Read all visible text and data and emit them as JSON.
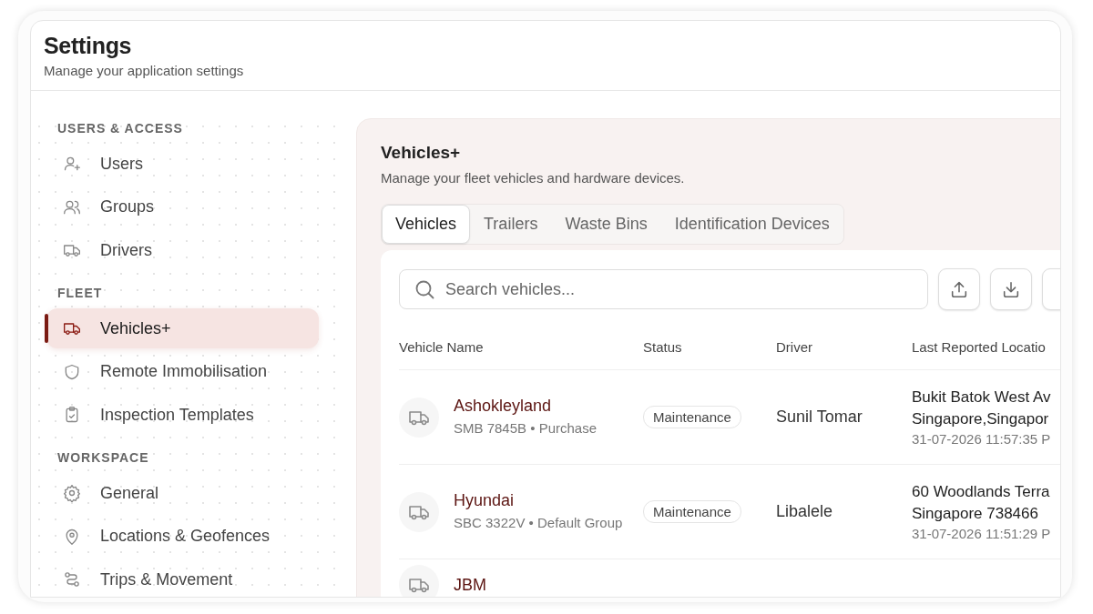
{
  "header": {
    "title": "Settings",
    "subtitle": "Manage your application settings"
  },
  "sidebar": {
    "sections": [
      {
        "label": "USERS & ACCESS",
        "items": [
          {
            "label": "Users",
            "selected": false
          },
          {
            "label": "Groups",
            "selected": false
          },
          {
            "label": "Drivers",
            "selected": false
          }
        ]
      },
      {
        "label": "FLEET",
        "items": [
          {
            "label": "Vehicles+",
            "selected": true
          },
          {
            "label": "Remote Immobilisation",
            "selected": false
          },
          {
            "label": "Inspection Templates",
            "selected": false
          }
        ]
      },
      {
        "label": "WORKSPACE",
        "items": [
          {
            "label": "General",
            "selected": false
          },
          {
            "label": "Locations & Geofences",
            "selected": false
          },
          {
            "label": "Trips & Movement",
            "selected": false
          }
        ]
      }
    ]
  },
  "panel": {
    "title": "Vehicles+",
    "subtitle": "Manage your fleet vehicles and hardware devices.",
    "tabs": [
      {
        "label": "Vehicles",
        "selected": true
      },
      {
        "label": "Trailers",
        "selected": false
      },
      {
        "label": "Waste Bins",
        "selected": false
      },
      {
        "label": "Identification Devices",
        "selected": false
      }
    ],
    "search": {
      "placeholder": "Search vehicles..."
    },
    "table": {
      "columns": [
        "Vehicle Name",
        "Status",
        "Driver",
        "Last Reported Locatio"
      ],
      "rows": [
        {
          "name": "Ashokleyland",
          "details": "SMB 7845B • Purchase",
          "status": "Maintenance",
          "driver": "Sunil Tomar",
          "location": [
            "Bukit Batok West Av",
            "Singapore,Singapor"
          ],
          "time": "31-07-2026 11:57:35 P"
        },
        {
          "name": "Hyundai",
          "details": "SBC 3322V • Default Group",
          "status": "Maintenance",
          "driver": "Libalele",
          "location": [
            "60 Woodlands Terra",
            "Singapore 738466"
          ],
          "time": "31-07-2026 11:51:29 P"
        },
        {
          "name": "JBM"
        }
      ]
    }
  }
}
